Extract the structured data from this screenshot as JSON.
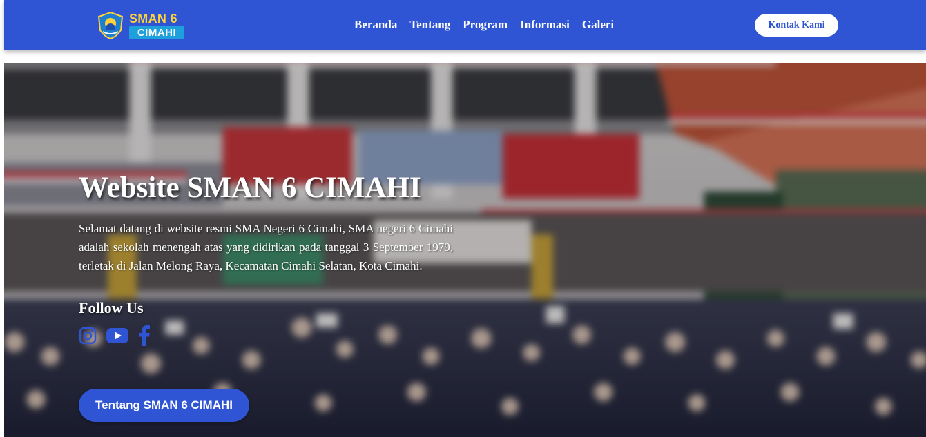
{
  "brand": {
    "name_top": "SMAN 6",
    "name_bottom": "CIMAHI"
  },
  "nav": {
    "items": [
      {
        "label": "Beranda"
      },
      {
        "label": "Tentang"
      },
      {
        "label": "Program"
      },
      {
        "label": "Informasi"
      },
      {
        "label": "Galeri"
      }
    ],
    "contact_label": "Kontak Kami"
  },
  "hero": {
    "title": "Website SMAN 6 CIMAHI",
    "description": "Selamat datang di website resmi SMA Negeri 6 Cimahi, SMA negeri 6 Cimahi adalah sekolah menengah atas yang didirikan pada tanggal 3 September 1979, terletak di Jalan Melong Raya, Kecamatan Cimahi Selatan, Kota Cimahi.",
    "follow_title": "Follow Us",
    "social": [
      {
        "icon": "instagram-icon"
      },
      {
        "icon": "youtube-icon"
      },
      {
        "icon": "facebook-icon"
      }
    ],
    "cta_label": "Tentang SMAN 6 CIMAHI"
  },
  "colors": {
    "primary": "#2f55d4",
    "logo_yellow": "#ffd23a",
    "logo_blue": "#1ea0dc",
    "white": "#ffffff"
  }
}
